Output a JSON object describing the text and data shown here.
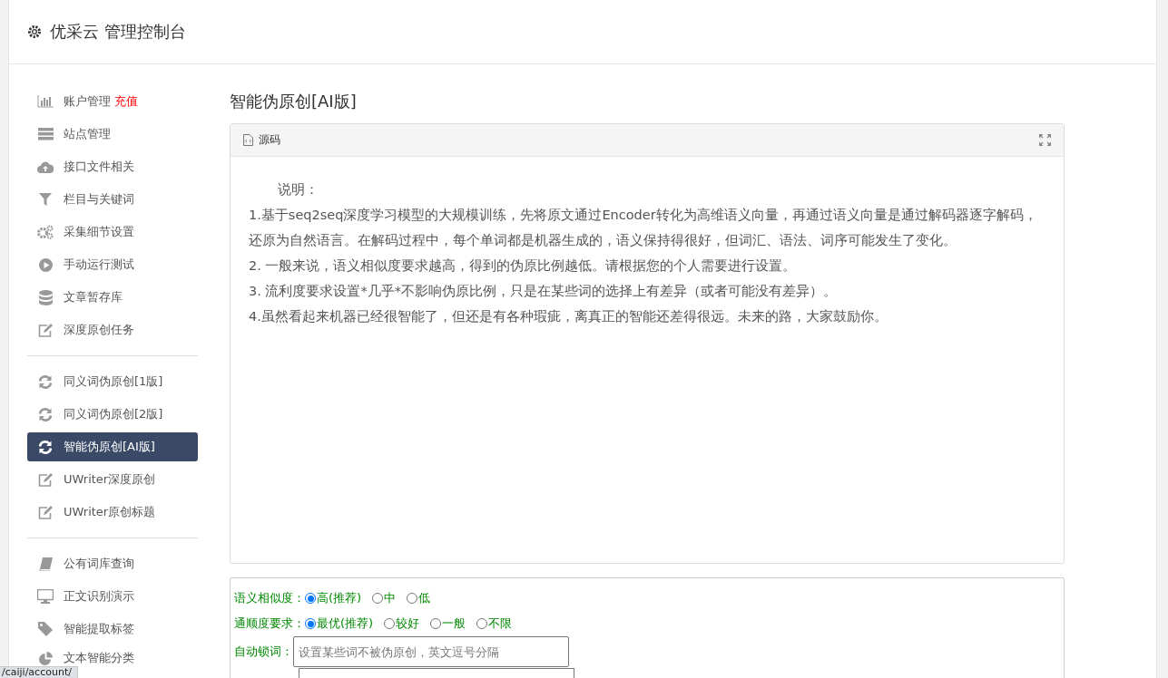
{
  "header": {
    "title": "优采云 管理控制台"
  },
  "sidebar": {
    "groups": [
      {
        "items": [
          {
            "label": "账户管理",
            "badge": "充值",
            "selected": false
          },
          {
            "label": "站点管理",
            "selected": false
          },
          {
            "label": "接口文件相关",
            "selected": false
          },
          {
            "label": "栏目与关键词",
            "selected": false
          },
          {
            "label": "采集细节设置",
            "selected": false
          },
          {
            "label": "手动运行测试",
            "selected": false
          },
          {
            "label": "文章暂存库",
            "selected": false
          },
          {
            "label": "深度原创任务",
            "selected": false
          }
        ]
      },
      {
        "items": [
          {
            "label": "同义词伪原创[1版]",
            "selected": false
          },
          {
            "label": "同义词伪原创[2版]",
            "selected": false
          },
          {
            "label": "智能伪原创[AI版]",
            "selected": true
          },
          {
            "label": "UWriter深度原创",
            "selected": false
          },
          {
            "label": "UWriter原创标题",
            "selected": false
          }
        ]
      },
      {
        "items": [
          {
            "label": "公有词库查询",
            "selected": false
          },
          {
            "label": "正文识别演示",
            "selected": false
          },
          {
            "label": "智能提取标签",
            "selected": false
          },
          {
            "label": "文本智能分类",
            "selected": false
          }
        ]
      }
    ]
  },
  "content": {
    "title": "智能伪原创[AI版]",
    "editor": {
      "toolbar_label": "源码",
      "paragraphs": [
        "说明：",
        "1.基于seq2seq深度学习模型的大规模训练，先将原文通过Encoder转化为高维语义向量，再通过语义向量是通过解码器逐字解码，还原为自然语言。在解码过程中，每个单词都是机器生成的，语义保持得很好，但词汇、语法、词序可能发生了变化。",
        "2. 一般来说，语义相似度要求越高，得到的伪原比例越低。请根据您的个人需要进行设置。",
        "3. 流利度要求设置*几乎*不影响伪原比例，只是在某些词的选择上有差异（或者可能没有差异）。",
        "4.虽然看起来机器已经很智能了，但还是有各种瑕疵，离真正的智能还差得很远。未来的路，大家鼓励你。"
      ]
    },
    "form": {
      "rows": [
        {
          "kind": "radio",
          "label": "语义相似度：",
          "options": [
            {
              "label": "高(推荐)",
              "selected": true
            },
            {
              "label": "中",
              "selected": false
            },
            {
              "label": "低",
              "selected": false
            }
          ]
        },
        {
          "kind": "radio",
          "label": "通顺度要求：",
          "options": [
            {
              "label": "最优(推荐)",
              "selected": true
            },
            {
              "label": "较好",
              "selected": false
            },
            {
              "label": "一般",
              "selected": false
            },
            {
              "label": "不限",
              "selected": false
            }
          ]
        },
        {
          "kind": "input",
          "label": "自动锁词：",
          "placeholder": "设置某些词不被伪原创，英文逗号分隔"
        }
      ]
    }
  },
  "status_bar": {
    "url": "/caiji/account/"
  }
}
